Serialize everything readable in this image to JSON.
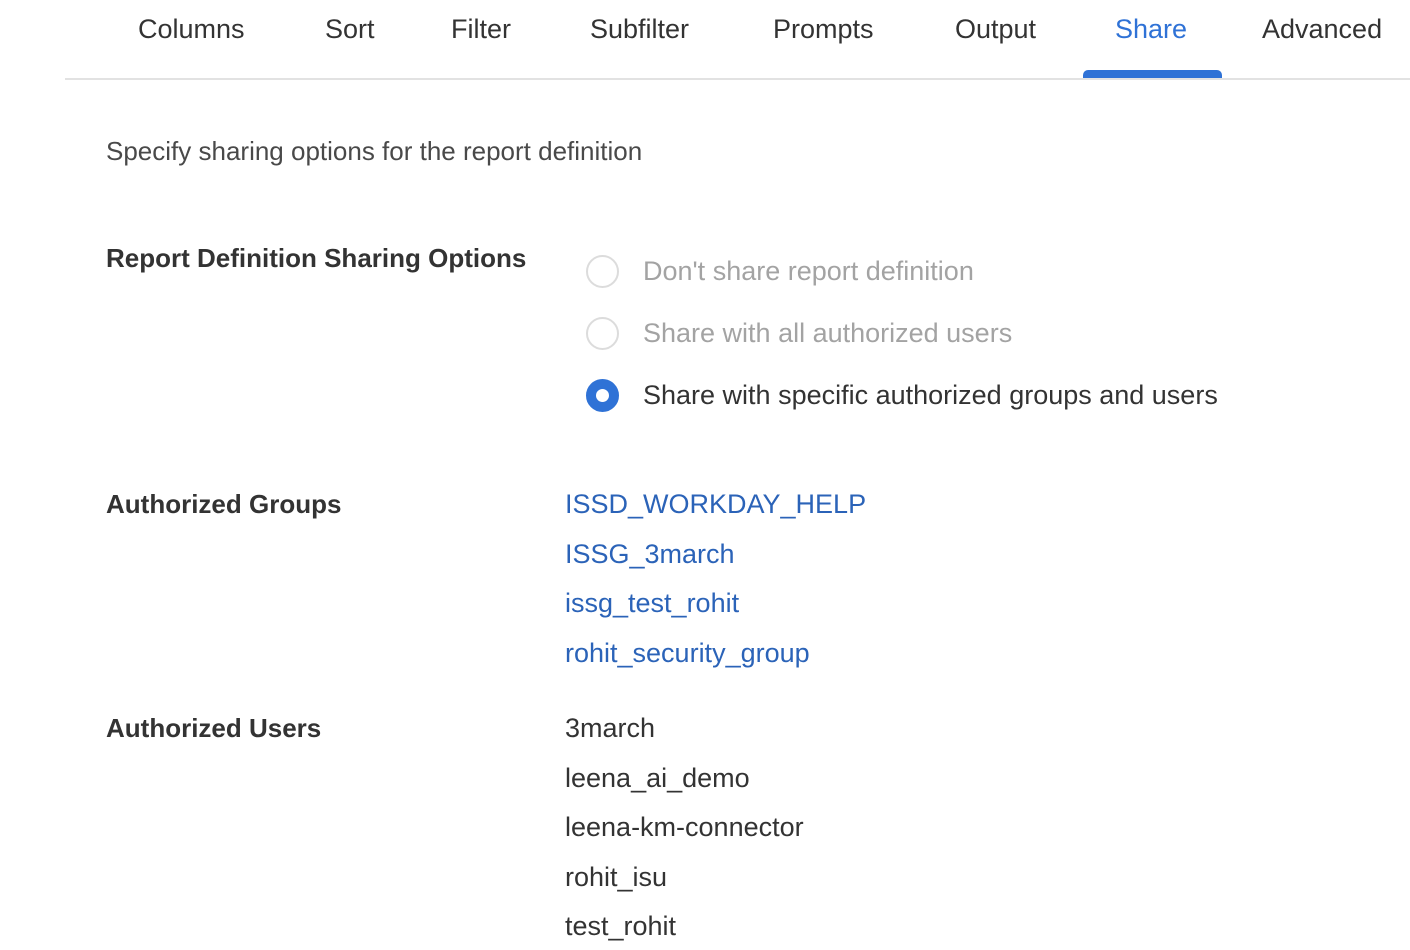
{
  "tabs": [
    {
      "label": "Columns"
    },
    {
      "label": "Sort"
    },
    {
      "label": "Filter"
    },
    {
      "label": "Subfilter"
    },
    {
      "label": "Prompts"
    },
    {
      "label": "Output"
    },
    {
      "label": "Share",
      "active": true
    },
    {
      "label": "Advanced"
    }
  ],
  "accent_color": "#2f72d6",
  "link_color": "#2b63b8",
  "intro_text": "Specify sharing options for the report definition",
  "sharing": {
    "label": "Report Definition Sharing Options",
    "options": [
      {
        "label": "Don't share report definition",
        "selected": false,
        "disabled": true
      },
      {
        "label": "Share with all authorized users",
        "selected": false,
        "disabled": true
      },
      {
        "label": "Share with specific authorized groups and users",
        "selected": true,
        "disabled": false
      }
    ]
  },
  "groups": {
    "label": "Authorized Groups",
    "items": [
      "ISSD_WORKDAY_HELP",
      "ISSG_3march",
      "issg_test_rohit",
      "rohit_security_group"
    ]
  },
  "users": {
    "label": "Authorized Users",
    "items": [
      "3march",
      "leena_ai_demo",
      "leena-km-connector",
      "rohit_isu",
      "test_rohit"
    ]
  }
}
